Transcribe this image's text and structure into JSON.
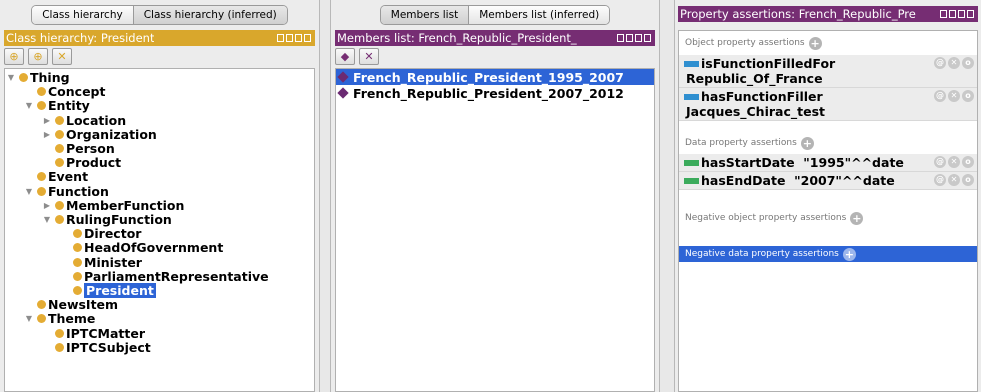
{
  "left": {
    "tabs": [
      "Class hierarchy",
      "Class hierarchy (inferred)"
    ],
    "header_title": "Class hierarchy: President",
    "toolbar_icons": [
      "add-subclass-icon",
      "add-sibling-icon",
      "delete-class-icon"
    ],
    "tree": [
      {
        "label": "Thing",
        "toggle": "▼"
      },
      {
        "label": "Concept",
        "toggle": ""
      },
      {
        "label": "Entity",
        "toggle": "▼"
      },
      {
        "label": "Location",
        "toggle": "▶"
      },
      {
        "label": "Organization",
        "toggle": "▶"
      },
      {
        "label": "Person",
        "toggle": ""
      },
      {
        "label": "Product",
        "toggle": ""
      },
      {
        "label": "Event",
        "toggle": ""
      },
      {
        "label": "Function",
        "toggle": "▼"
      },
      {
        "label": "MemberFunction",
        "toggle": "▶"
      },
      {
        "label": "RulingFunction",
        "toggle": "▼"
      },
      {
        "label": "Director",
        "toggle": ""
      },
      {
        "label": "HeadOfGovernment",
        "toggle": ""
      },
      {
        "label": "Minister",
        "toggle": ""
      },
      {
        "label": "ParliamentRepresentative",
        "toggle": ""
      },
      {
        "label": "President",
        "toggle": "",
        "selected": true
      },
      {
        "label": "NewsItem",
        "toggle": ""
      },
      {
        "label": "Theme",
        "toggle": "▼"
      },
      {
        "label": "IPTCMatter",
        "toggle": ""
      },
      {
        "label": "IPTCSubject",
        "toggle": ""
      }
    ]
  },
  "middle": {
    "tabs": [
      "Members list",
      "Members list (inferred)"
    ],
    "header_title": "Members list: French_Republic_President_",
    "toolbar_icons": [
      "add-individual-icon",
      "delete-individual-icon"
    ],
    "members": [
      {
        "label": "French_Republic_President_1995_2007",
        "selected": true
      },
      {
        "label": "French_Republic_President_2007_2012",
        "selected": false
      }
    ]
  },
  "right": {
    "header_title": "Property assertions: French_Republic_Pre",
    "object_section_label": "Object property assertions",
    "object_assertions": [
      {
        "line1": "isFunctionFilledFor",
        "line2": "Republic_Of_France"
      },
      {
        "line1": "hasFunctionFiller",
        "line2": "Jacques_Chirac_test"
      }
    ],
    "data_section_label": "Data property assertions",
    "data_assertions": [
      {
        "text": "hasStartDate  \"1995\"^^date"
      },
      {
        "text": "hasEndDate  \"2007\"^^date"
      }
    ],
    "negative_object_label": "Negative object property assertions",
    "negative_data_label": "Negative data property assertions"
  },
  "colors": {
    "class_header": "#d9a72c",
    "individual_header": "#762d73",
    "selection": "#2d64d6",
    "class_dot": "#e4ac34",
    "object_property": "#2f8fd0",
    "data_property": "#3bab5c"
  }
}
